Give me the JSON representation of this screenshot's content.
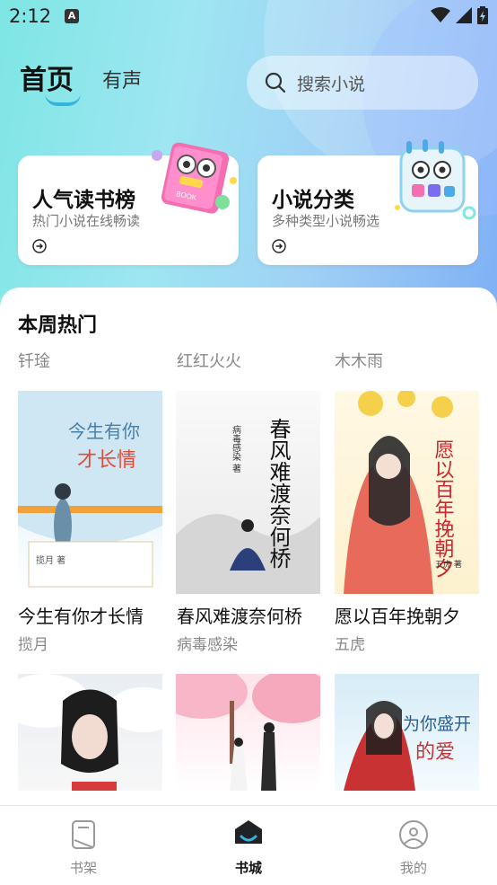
{
  "status": {
    "time": "2:12",
    "app_icon_letter": "A"
  },
  "header": {
    "tabs": [
      {
        "label": "首页",
        "active": true
      },
      {
        "label": "有声",
        "active": false
      }
    ],
    "search_placeholder": "搜索小说"
  },
  "feature_cards": [
    {
      "title": "人气读书榜",
      "subtitle": "热门小说在线畅读",
      "illustration_text": "BOOK"
    },
    {
      "title": "小说分类",
      "subtitle": "多种类型小说畅选"
    }
  ],
  "weekly_hot": {
    "title": "本周热门",
    "top_authors": [
      "钎琻",
      "红红火火",
      "木木雨"
    ],
    "books": [
      {
        "title": "今生有你才长情",
        "author": "揽月",
        "cover_title_1": "今生有你",
        "cover_title_2": "才长情",
        "cover_author": "揽月 著"
      },
      {
        "title": "春风难渡奈何桥",
        "author": "病毒感染",
        "cover_title": "春风难渡奈何桥",
        "cover_author": "病毒感染 著"
      },
      {
        "title": "愿以百年挽朝夕",
        "author": "五虎",
        "cover_title": "愿以百年挽朝夕",
        "cover_author": "五虎 著"
      }
    ],
    "more_covers": [
      {
        "cover_text": ""
      },
      {
        "cover_text": ""
      },
      {
        "cover_title_1": "为你盛开",
        "cover_title_2": "的爱"
      }
    ]
  },
  "tabbar": {
    "items": [
      {
        "label": "书架",
        "active": false
      },
      {
        "label": "书城",
        "active": true
      },
      {
        "label": "我的",
        "active": false
      }
    ]
  },
  "colors": {
    "accent": "#35b4dc",
    "header_gradient_start": "#7ee6e4",
    "header_gradient_end": "#7fb0f5"
  }
}
